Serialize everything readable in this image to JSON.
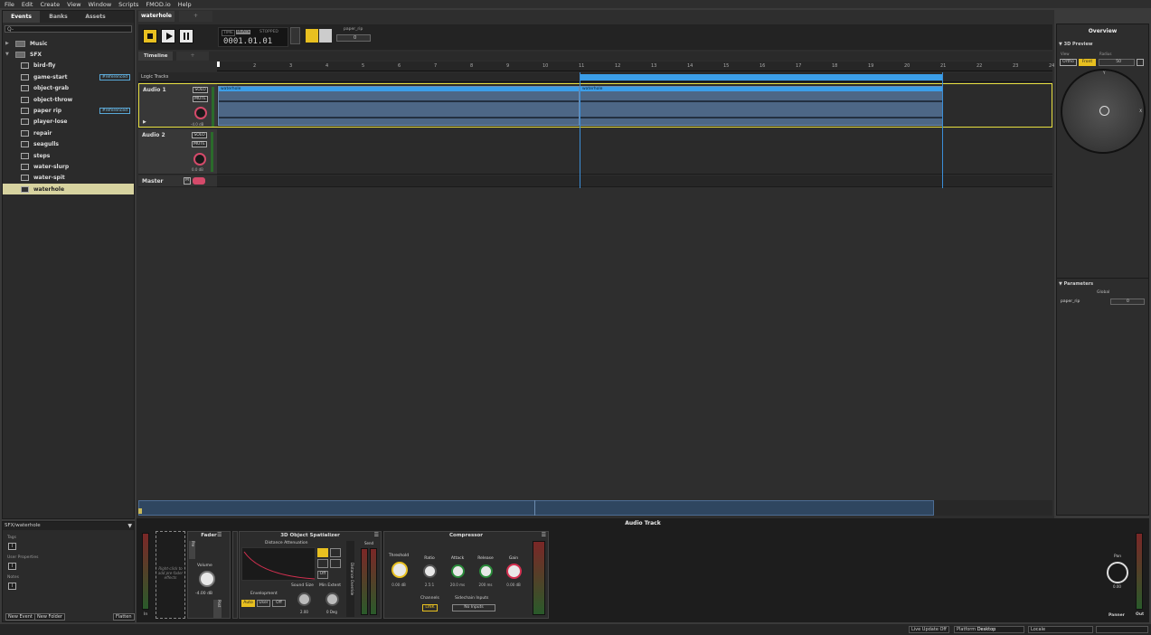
{
  "menu": [
    "File",
    "Edit",
    "Create",
    "View",
    "Window",
    "Scripts",
    "FMOD.io",
    "Help"
  ],
  "browser": {
    "tabs": [
      "Events",
      "Banks",
      "Assets"
    ],
    "search_placeholder": "Q-",
    "tree": [
      {
        "label": "Music",
        "type": "folder"
      },
      {
        "label": "SFX",
        "type": "folder"
      },
      {
        "label": "bird-fly",
        "type": "event"
      },
      {
        "label": "game-start",
        "type": "event",
        "badge": "#referenced"
      },
      {
        "label": "object-grab",
        "type": "event"
      },
      {
        "label": "object-throw",
        "type": "event"
      },
      {
        "label": "paper rip",
        "type": "event",
        "badge": "#referenced"
      },
      {
        "label": "player-lose",
        "type": "event"
      },
      {
        "label": "repair",
        "type": "event"
      },
      {
        "label": "seagulls",
        "type": "event"
      },
      {
        "label": "steps",
        "type": "event"
      },
      {
        "label": "water-slurp",
        "type": "event"
      },
      {
        "label": "water-spit",
        "type": "event"
      },
      {
        "label": "waterhole",
        "type": "event",
        "selected": true
      }
    ],
    "path": "SFX/waterhole",
    "sections": [
      "Tags",
      "User Properties",
      "Notes"
    ],
    "buttons": [
      "New Event",
      "New Folder",
      "Flatten"
    ]
  },
  "editor": {
    "event_tab": "waterhole",
    "new_tab": "+",
    "lcd": {
      "mode_time": "TIME",
      "mode_beats": "BEATS",
      "state": "STOPPED",
      "position": "0001.01.01"
    },
    "param": {
      "name": "paper_rip",
      "value": "0"
    },
    "timeline_tab": "Timeline",
    "ruler": [
      "1",
      "2",
      "3",
      "4",
      "5",
      "6",
      "7",
      "8",
      "9",
      "10",
      "11",
      "12",
      "13",
      "14",
      "15",
      "16",
      "17",
      "18",
      "19",
      "20",
      "21",
      "22",
      "23",
      "24"
    ],
    "logic_tracks": "Logic Tracks",
    "tracks": [
      {
        "name": "Audio 1",
        "solo": "SOLO",
        "mute": "MUTE",
        "volume": "-4.0 dB",
        "regions": [
          "waterhole",
          "waterhole"
        ]
      },
      {
        "name": "Audio 2",
        "solo": "SOLO",
        "mute": "MUTE",
        "volume": "0.0 dB",
        "regions": []
      }
    ],
    "master": {
      "name": "Master",
      "m": "M"
    }
  },
  "overview": {
    "title": "Overview",
    "preview": "3D Preview",
    "view_label": "View",
    "radius_label": "Radius",
    "ortho": "Ortho",
    "front": "Front",
    "radius": "50",
    "axis_y": "Y",
    "axis_x": "X",
    "parameters": "Parameters",
    "global": "Global",
    "param_name": "paper_rip",
    "param_value": "0"
  },
  "deck": {
    "title": "Audio Track",
    "in": "In",
    "out": "Out",
    "insert_hint": "Right-click to add pre-fader effects",
    "fader": {
      "title": "Fader",
      "volume_label": "Volume",
      "volume": "-4.00 dB",
      "pre": "Pre",
      "post": "Post"
    },
    "spatializer": {
      "title": "3D Object Spatializer",
      "distance": "Distance Attenuation",
      "off": "Off",
      "envelopment": "Envelopment",
      "auto": "Auto",
      "user": "User",
      "off2": "Off",
      "sound_size": "Sound Size",
      "sound_size_val": "2.00",
      "min_extent": "Min Extent",
      "min_extent_val": "0 Deg",
      "send": "Send",
      "override": "Distance Override"
    },
    "compressor": {
      "title": "Compressor",
      "knobs": [
        {
          "label": "Threshold",
          "value": "0.00 dB"
        },
        {
          "label": "Ratio",
          "value": "2.5:1"
        },
        {
          "label": "Attack",
          "value": "20.0 ms"
        },
        {
          "label": "Release",
          "value": "200 ms"
        },
        {
          "label": "Gain",
          "value": "0.00 dB"
        }
      ],
      "channels": "Channels",
      "link": "LINK",
      "sidechain": "Sidechain Inputs",
      "no_inputs": "No Inputs"
    },
    "panner": {
      "label": "Pan",
      "value": "0.00",
      "name": "Panner"
    }
  },
  "status": {
    "live_update": "Live Update Off",
    "platform_label": "Platform",
    "platform": "Desktop",
    "locale_label": "Locale"
  },
  "colors": {
    "accent": "#e8c020",
    "region": "#3b9ee8",
    "selected": "#d7d3a0"
  }
}
